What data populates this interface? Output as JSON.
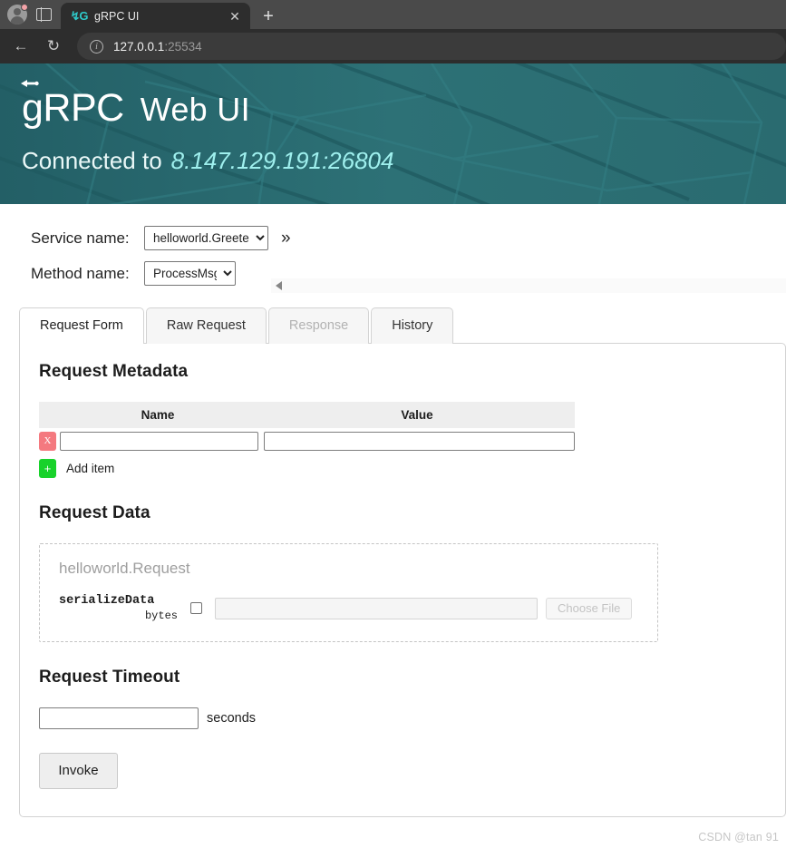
{
  "browser": {
    "avatar_name": "profile-avatar",
    "tab": {
      "favicon_text": "↯G",
      "title": "gRPC UI",
      "close_label": "✕"
    },
    "new_tab_label": "+",
    "back_label": "←",
    "reload_label": "↻",
    "omnibox": {
      "info_label": "i",
      "url_host": "127.0.0.1",
      "url_port": ":25534"
    }
  },
  "banner": {
    "logo_g": "g",
    "logo_rest": "RPC",
    "title": "Web UI",
    "connected_label": "Connected to",
    "connected_address": "8.147.129.191:26804",
    "bg_color": "#2a6b70",
    "accent_color": "#9ff0ee"
  },
  "selectors": {
    "service_label": "Service name:",
    "service_value": "helloworld.Greeter",
    "service_options": [
      "helloworld.Greeter"
    ],
    "method_label": "Method name:",
    "method_value": "ProcessMsg",
    "method_options": [
      "ProcessMsg"
    ],
    "expand_label": "»",
    "scroll_arrow": "◀"
  },
  "tabs": [
    {
      "label": "Request Form",
      "state": "active"
    },
    {
      "label": "Raw Request",
      "state": "normal"
    },
    {
      "label": "Response",
      "state": "disabled"
    },
    {
      "label": "History",
      "state": "normal"
    }
  ],
  "metadata": {
    "title": "Request Metadata",
    "columns": [
      "Name",
      "Value"
    ],
    "rows": [
      {
        "delete_label": "X",
        "name_value": "",
        "value_value": ""
      }
    ],
    "add_button_label": "+",
    "add_label": "Add item",
    "delete_color": "#f4797f",
    "add_color": "#18d22b"
  },
  "request_data": {
    "title": "Request Data",
    "message_type": "helloworld.Request",
    "fields": [
      {
        "name": "serializeData",
        "type": "bytes",
        "checked": false,
        "value": "",
        "file_button_label": "Choose File"
      }
    ]
  },
  "timeout": {
    "title": "Request Timeout",
    "value": "",
    "unit_label": "seconds"
  },
  "invoke_label": "Invoke",
  "watermark": "CSDN @tan 91"
}
